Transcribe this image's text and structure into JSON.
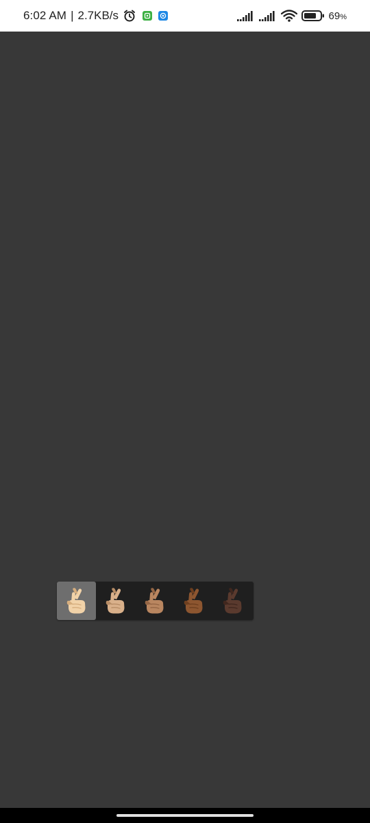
{
  "status_bar": {
    "time": "6:02 AM",
    "separator": "|",
    "network_speed": "2.7KB/s",
    "battery_level": "69",
    "battery_unit": "%",
    "icons": [
      "alarm-icon",
      "app-notification-green-icon",
      "app-notification-blue-icon",
      "signal-icon",
      "signal-icon",
      "wifi-icon",
      "battery-icon"
    ],
    "colors": {
      "green_badge": "#3cb043",
      "blue_badge": "#1e88e5"
    }
  },
  "skin_tone_picker": {
    "emoji_name": "crossed-fingers",
    "selected_index": 0,
    "options": [
      {
        "tone": "light",
        "skin": "#f1d2a8",
        "shade": "#d6ae7e"
      },
      {
        "tone": "medium-light",
        "skin": "#d9b08a",
        "shade": "#b88d66"
      },
      {
        "tone": "medium",
        "skin": "#b98660",
        "shade": "#956645"
      },
      {
        "tone": "medium-dark",
        "skin": "#8d5630",
        "shade": "#6e3f1f"
      },
      {
        "tone": "dark",
        "skin": "#5a3a2e",
        "shade": "#40271e"
      }
    ]
  },
  "colors": {
    "background": "#383838",
    "picker_bg": "#1f1f1f",
    "picker_selected": "#6e6e6e"
  }
}
